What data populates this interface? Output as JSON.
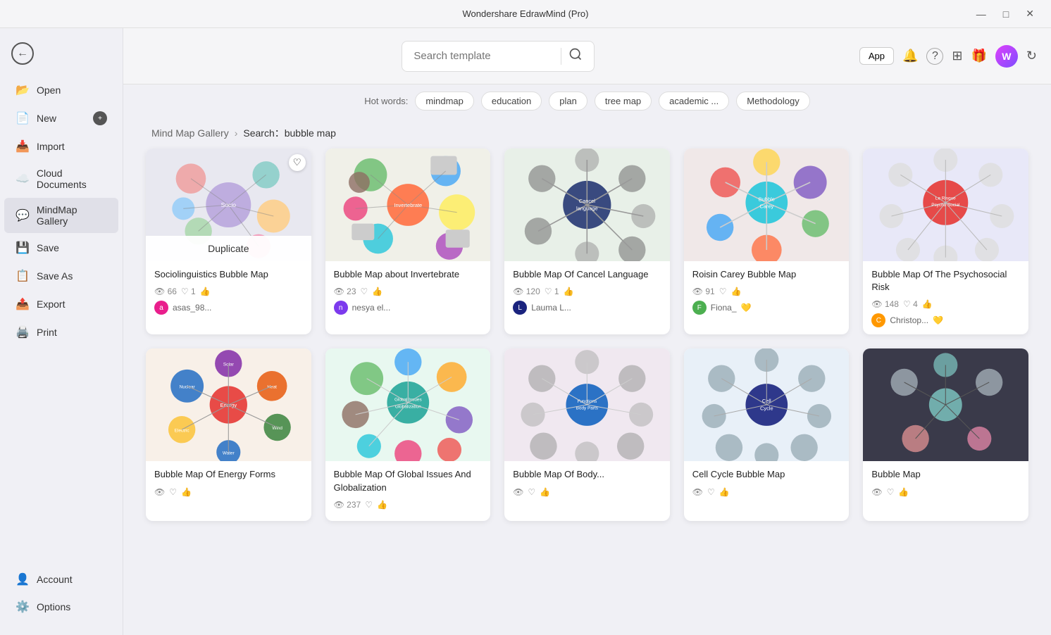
{
  "app": {
    "title": "Wondershare EdrawMind (Pro)",
    "back_icon": "←",
    "user_initial": "W",
    "app_btn_label": "App"
  },
  "sidebar": {
    "items": [
      {
        "id": "open",
        "label": "Open",
        "icon": "📂"
      },
      {
        "id": "new",
        "label": "New",
        "icon": "📄",
        "badge": "+"
      },
      {
        "id": "import",
        "label": "Import",
        "icon": "📥"
      },
      {
        "id": "cloud",
        "label": "Cloud Documents",
        "icon": "☁️"
      },
      {
        "id": "mindmap",
        "label": "MindMap Gallery",
        "icon": "💬",
        "active": true
      },
      {
        "id": "save",
        "label": "Save",
        "icon": "💾"
      },
      {
        "id": "saveas",
        "label": "Save As",
        "icon": "📋"
      },
      {
        "id": "export",
        "label": "Export",
        "icon": "📤"
      },
      {
        "id": "print",
        "label": "Print",
        "icon": "🖨️"
      }
    ],
    "bottom_items": [
      {
        "id": "account",
        "label": "Account",
        "icon": "👤"
      },
      {
        "id": "options",
        "label": "Options",
        "icon": "⚙️"
      }
    ]
  },
  "search": {
    "placeholder": "Search template",
    "search_icon": "🔍",
    "hot_words_label": "Hot words:",
    "hot_tags": [
      "mindmap",
      "education",
      "plan",
      "tree map",
      "academic ...",
      "Methodology"
    ]
  },
  "breadcrumb": {
    "gallery": "Mind Map Gallery",
    "separator": ">",
    "current": "Search：bubble map"
  },
  "gallery": {
    "section_title": "Mind Map Gallery",
    "cards": [
      {
        "id": 1,
        "title": "Sociolinguistics Bubble Map",
        "views": 66,
        "likes": 1,
        "has_favorite": true,
        "has_duplicate": true,
        "author": "asas_98...",
        "author_color": "#e91e8c",
        "thumb_class": "thumb-1"
      },
      {
        "id": 2,
        "title": "Bubble Map about Invertebrate",
        "views": 23,
        "likes": 0,
        "has_favorite": false,
        "author": "nesya el...",
        "author_color": "#7c3aed",
        "thumb_class": "thumb-2"
      },
      {
        "id": 3,
        "title": "Bubble Map Of Cancel Language",
        "views": 120,
        "likes": 1,
        "has_favorite": false,
        "author": "Lauma L...",
        "author_color": "#1a237e",
        "thumb_class": "thumb-3"
      },
      {
        "id": 4,
        "title": "Roisin Carey Bubble Map",
        "views": 91,
        "likes": 0,
        "has_favorite": false,
        "author": "Fiona_",
        "author_color": "#4caf50",
        "gold_author": true,
        "thumb_class": "thumb-4"
      },
      {
        "id": 5,
        "title": "Bubble Map Of The Psychosocial Risk",
        "views": 148,
        "likes": 4,
        "has_favorite": false,
        "author": "Christop...",
        "author_color": "#ff9800",
        "gold_author": true,
        "thumb_class": "thumb-5"
      },
      {
        "id": 6,
        "title": "Bubble Map Of Energy Forms",
        "views": 0,
        "likes": 0,
        "has_favorite": false,
        "author": "",
        "thumb_class": "thumb-6"
      },
      {
        "id": 7,
        "title": "Bubble Map Of Global Issues And Globalization",
        "views": 237,
        "likes": 0,
        "has_favorite": false,
        "author": "",
        "thumb_class": "thumb-7"
      },
      {
        "id": 8,
        "title": "Bubble Map Of Body...",
        "views": 0,
        "likes": 0,
        "has_favorite": false,
        "author": "",
        "thumb_class": "thumb-8"
      },
      {
        "id": 9,
        "title": "Cell Cycle Bubble Map",
        "views": 0,
        "likes": 0,
        "has_favorite": false,
        "author": "",
        "thumb_class": "thumb-9"
      },
      {
        "id": 10,
        "title": "Bubble Map",
        "views": 0,
        "likes": 0,
        "has_favorite": false,
        "author": "",
        "thumb_class": "thumb-dark"
      }
    ]
  },
  "icons": {
    "back": "←",
    "search": "⌕",
    "bell": "🔔",
    "help": "?",
    "grid": "⊞",
    "gift": "🎁",
    "refresh": "↻",
    "heart": "♡",
    "eye": "👁",
    "thumbup": "👍",
    "heart_filled": "♥"
  }
}
